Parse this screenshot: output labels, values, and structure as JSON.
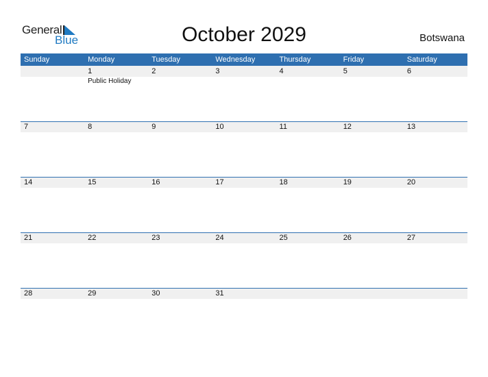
{
  "logo": {
    "word1": "General",
    "word2": "Blue"
  },
  "title": "October 2029",
  "country": "Botswana",
  "weekdays": [
    "Sunday",
    "Monday",
    "Tuesday",
    "Wednesday",
    "Thursday",
    "Friday",
    "Saturday"
  ],
  "weeks": [
    [
      {
        "d": ""
      },
      {
        "d": "1",
        "ev": "Public Holiday"
      },
      {
        "d": "2"
      },
      {
        "d": "3"
      },
      {
        "d": "4"
      },
      {
        "d": "5"
      },
      {
        "d": "6"
      }
    ],
    [
      {
        "d": "7"
      },
      {
        "d": "8"
      },
      {
        "d": "9"
      },
      {
        "d": "10"
      },
      {
        "d": "11"
      },
      {
        "d": "12"
      },
      {
        "d": "13"
      }
    ],
    [
      {
        "d": "14"
      },
      {
        "d": "15"
      },
      {
        "d": "16"
      },
      {
        "d": "17"
      },
      {
        "d": "18"
      },
      {
        "d": "19"
      },
      {
        "d": "20"
      }
    ],
    [
      {
        "d": "21"
      },
      {
        "d": "22"
      },
      {
        "d": "23"
      },
      {
        "d": "24"
      },
      {
        "d": "25"
      },
      {
        "d": "26"
      },
      {
        "d": "27"
      }
    ],
    [
      {
        "d": "28"
      },
      {
        "d": "29"
      },
      {
        "d": "30"
      },
      {
        "d": "31"
      },
      {
        "d": ""
      },
      {
        "d": ""
      },
      {
        "d": ""
      }
    ]
  ],
  "colors": {
    "accent": "#2e6fb0",
    "band": "#f0f0f0",
    "logo_blue": "#1f7ac2"
  }
}
